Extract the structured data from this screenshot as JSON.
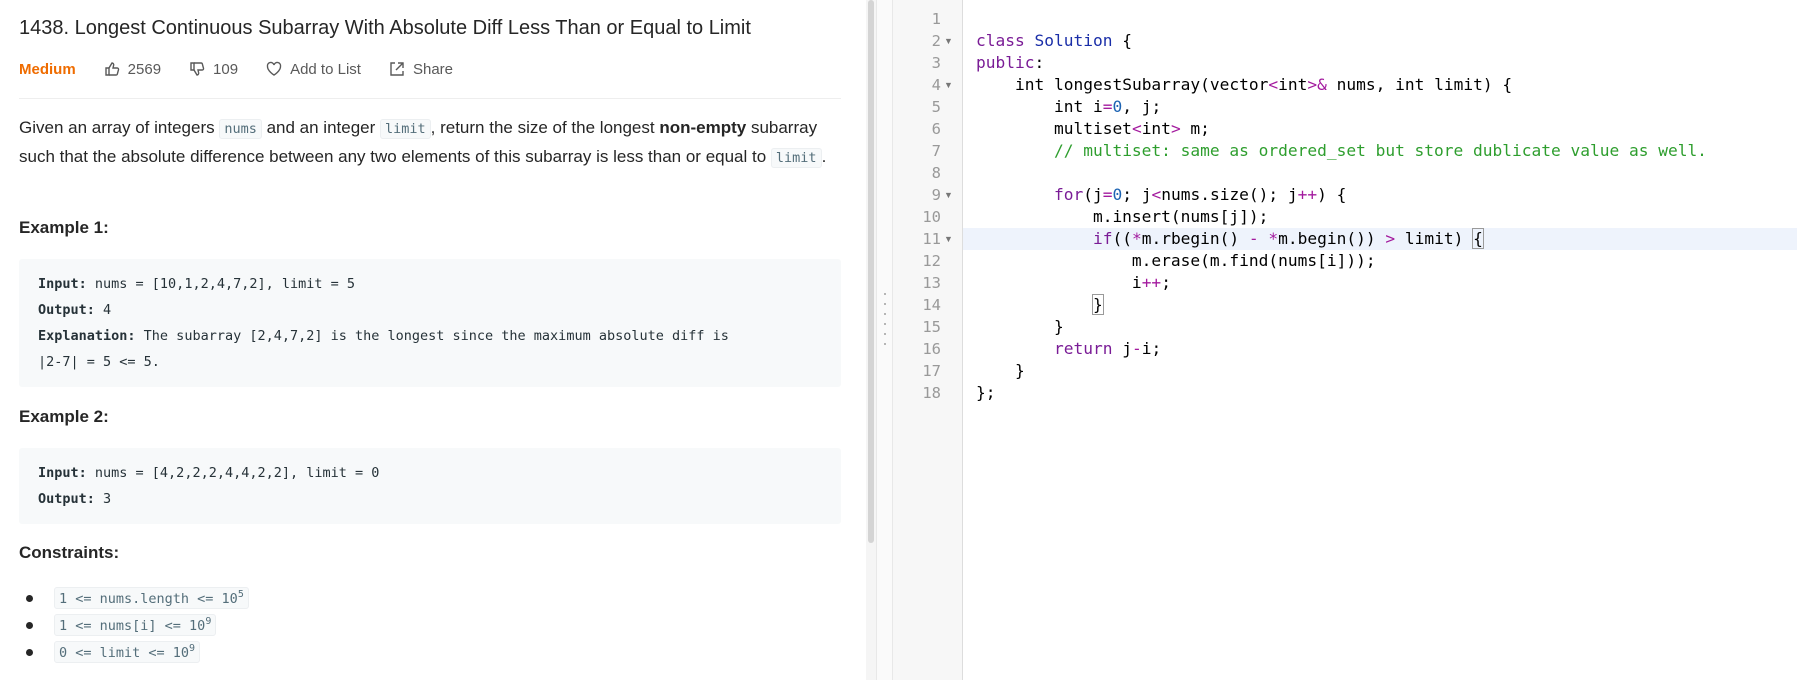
{
  "problem": {
    "title": "1438. Longest Continuous Subarray With Absolute Diff Less Than or Equal to Limit",
    "difficulty": "Medium",
    "likes": "2569",
    "dislikes": "109",
    "add_to_list": "Add to List",
    "share": "Share",
    "description": {
      "p1": "Given an array of integers ",
      "code_nums": "nums",
      "p2": " and an integer ",
      "code_limit": "limit",
      "p3": ", return the size of the longest ",
      "bold": "non-empty",
      "p4": " subarray such that the absolute difference between any two elements of this subarray is less than or equal to ",
      "code_limit2": "limit",
      "p5": "."
    },
    "examples": [
      {
        "heading": "Example 1:",
        "input_label": "Input:",
        "input": " nums = [10,1,2,4,7,2], limit = 5",
        "output_label": "Output:",
        "output": " 4",
        "explanation_label": "Explanation:",
        "explanation": " The subarray [2,4,7,2] is the longest since the maximum absolute diff is",
        "explanation2": "|2-7| = 5 <= 5."
      },
      {
        "heading": "Example 2:",
        "input_label": "Input:",
        "input": " nums = [4,2,2,2,4,4,2,2], limit = 0",
        "output_label": "Output:",
        "output": " 3"
      }
    ],
    "constraints_heading": "Constraints:",
    "constraints": [
      {
        "text": "1 <= nums.length <= 10",
        "sup": "5"
      },
      {
        "text": "1 <= nums[i] <= 10",
        "sup": "9"
      },
      {
        "text": "0 <= limit <= 10",
        "sup": "9"
      }
    ]
  },
  "editor": {
    "line_numbers": [
      "1",
      "2",
      "3",
      "4",
      "5",
      "6",
      "7",
      "8",
      "9",
      "10",
      "11",
      "12",
      "13",
      "14",
      "15",
      "16",
      "17",
      "18"
    ],
    "fold_lines": [
      "2",
      "4",
      "9",
      "11"
    ],
    "active_line": "11"
  }
}
